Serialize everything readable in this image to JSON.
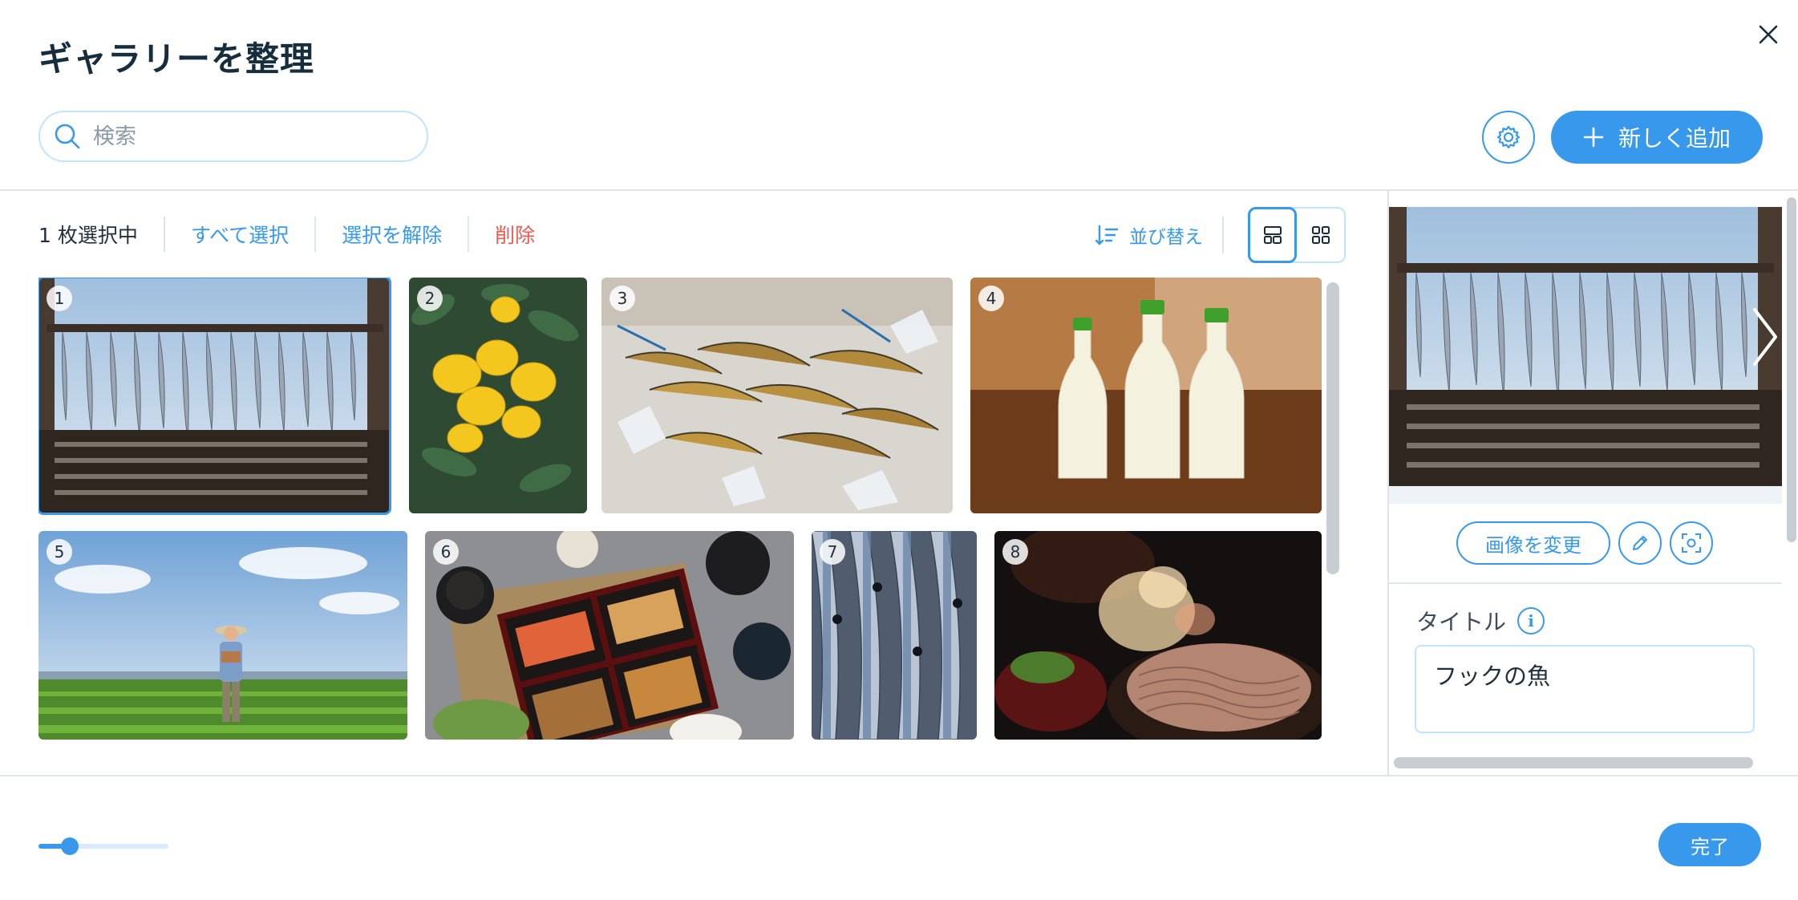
{
  "header": {
    "title": "ギャラリーを整理",
    "close_icon": "close-icon"
  },
  "search": {
    "placeholder": "検索",
    "value": ""
  },
  "actions": {
    "settings_icon": "gear-icon",
    "add_label": "新しく追加"
  },
  "toolbar": {
    "selection_count": "1 枚選択中",
    "select_all": "すべて選択",
    "deselect": "選択を解除",
    "delete": "削除",
    "sort": "並び替え",
    "view_modes": [
      "masonry-view",
      "grid-view"
    ],
    "active_view": "masonry-view"
  },
  "gallery": {
    "items": [
      {
        "number": "1",
        "subject": "hanging fish",
        "selected": true
      },
      {
        "number": "2",
        "subject": "lemons"
      },
      {
        "number": "3",
        "subject": "prawns on ice"
      },
      {
        "number": "4",
        "subject": "milk bottles"
      },
      {
        "number": "5",
        "subject": "farmer in field"
      },
      {
        "number": "6",
        "subject": "bento box"
      },
      {
        "number": "7",
        "subject": "sardines"
      },
      {
        "number": "8",
        "subject": "soba and tempura"
      }
    ]
  },
  "panel": {
    "change_image": "画像を変更",
    "edit_icon": "pencil-icon",
    "focal_icon": "focal-point-icon",
    "title_label": "タイトル",
    "info_icon": "i",
    "title_value": "フックの魚"
  },
  "footer": {
    "zoom_level": 0.25,
    "done": "完了"
  },
  "colors": {
    "accent": "#3899ec",
    "danger": "#ee5951",
    "text": "#162d3d"
  }
}
